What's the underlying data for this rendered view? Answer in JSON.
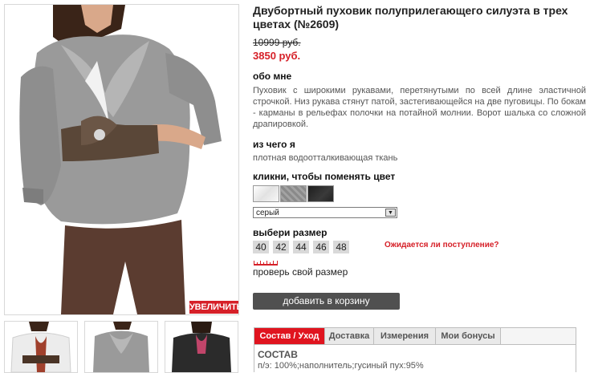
{
  "product": {
    "title": "Двубортный пуховик полуприлегающего силуэта в трех цветах (№2609)",
    "old_price": "10999 руб.",
    "new_price": "3850 руб."
  },
  "about": {
    "heading": "обо мне",
    "text": "Пуховик с широкими рукавами, перетянутыми по всей длине эластичной строчкой. Низ рукава стянут патой, застегивающейся на две пуговицы. По бокам - карманы в рельефах полочки на потайной молнии. Ворот шалька со сложной драпировкой."
  },
  "material": {
    "heading": "из чего я",
    "text": "плотная водоотталкивающая ткань"
  },
  "color": {
    "heading": "кликни, чтобы поменять цвет",
    "swatches": [
      {
        "name": "white",
        "hex": "#f4f4f4"
      },
      {
        "name": "grey",
        "hex": "#8d8d8d"
      },
      {
        "name": "black",
        "hex": "#262626"
      }
    ],
    "selected": "серый"
  },
  "size": {
    "heading": "выбери размер",
    "options": [
      "40",
      "42",
      "44",
      "46",
      "48"
    ],
    "notify": "Ожидается ли поступление?",
    "check": "проверь свой размер"
  },
  "image": {
    "zoom_label": "УВЕЛИЧИТЬ"
  },
  "cart": {
    "label": "добавить в корзину"
  },
  "tabs": {
    "items": [
      "Состав / Уход",
      "Доставка",
      "Измерения",
      "Мои бонусы"
    ],
    "section_title": "СОСТАВ",
    "section_text": "п/э: 100%;наполнитель;гусиный пух:95%"
  },
  "colors": {
    "accent": "#d62028",
    "button": "#505050"
  }
}
